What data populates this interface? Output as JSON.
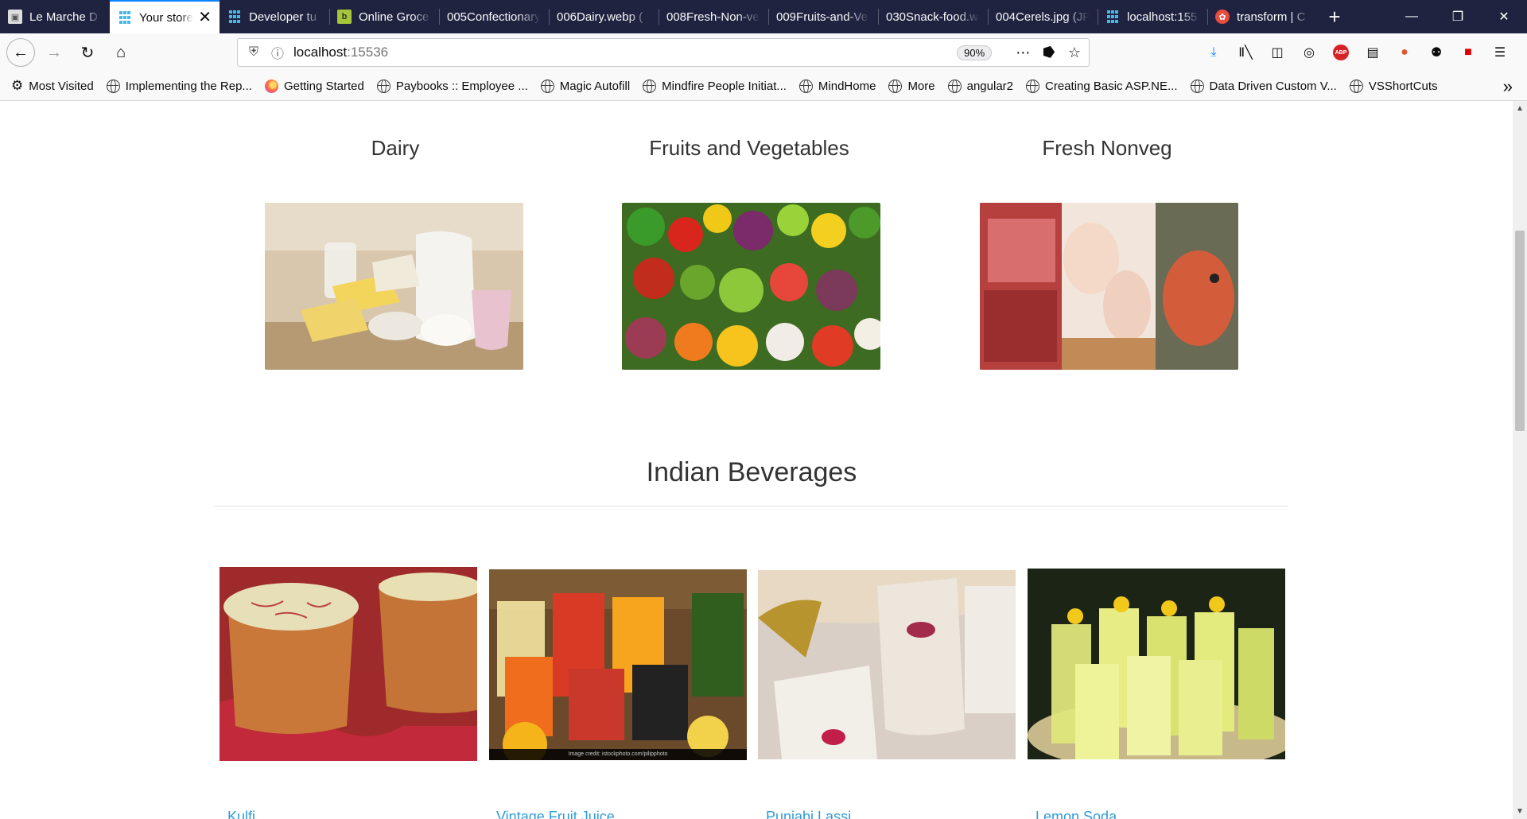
{
  "browser": {
    "tabs": [
      {
        "title": "Le Marche D",
        "icon": "cube-icon",
        "active": false
      },
      {
        "title": "Your store",
        "icon": "grid-icon",
        "active": true
      },
      {
        "title": "Developer tu",
        "icon": "grid-icon",
        "active": false
      },
      {
        "title": "Online Groce",
        "icon": "bb-icon",
        "active": false
      },
      {
        "title": "005Confectionary",
        "icon": "",
        "active": false
      },
      {
        "title": "006Dairy.webp (",
        "icon": "",
        "active": false
      },
      {
        "title": "008Fresh-Non-ve",
        "icon": "",
        "active": false
      },
      {
        "title": "009Fruits-and-Ve",
        "icon": "",
        "active": false
      },
      {
        "title": "030Snack-food.w",
        "icon": "",
        "active": false
      },
      {
        "title": "004Cerels.jpg (JP",
        "icon": "",
        "active": false
      },
      {
        "title": "localhost:155",
        "icon": "grid-icon",
        "active": false
      },
      {
        "title": "transform | C",
        "icon": "flower-icon",
        "active": false
      }
    ],
    "url": {
      "host": "localhost",
      "port": ":15536"
    },
    "zoom": "90%",
    "bookmarks": [
      "Most Visited",
      "Implementing the Rep...",
      "Getting Started",
      "Paybooks :: Employee ...",
      "Magic Autofill",
      "Mindfire People Initiat...",
      "MindHome",
      "More",
      "angular2",
      "Creating Basic ASP.NE...",
      "Data Driven Custom V...",
      "VSShortCuts"
    ],
    "extensions": {
      "abp_label": "ABP"
    }
  },
  "categories": [
    {
      "name": "Dairy"
    },
    {
      "name": "Fruits and Vegetables"
    },
    {
      "name": "Fresh Nonveg"
    }
  ],
  "beverages": {
    "title": "Indian Beverages",
    "items": [
      {
        "name": "Kulfi"
      },
      {
        "name": "Vintage Fruit Juice"
      },
      {
        "name": "Punjabi Lassi"
      },
      {
        "name": "Lemon Soda"
      }
    ],
    "image_credit": "Image credit: istockphoto.com/pilipphoto"
  }
}
